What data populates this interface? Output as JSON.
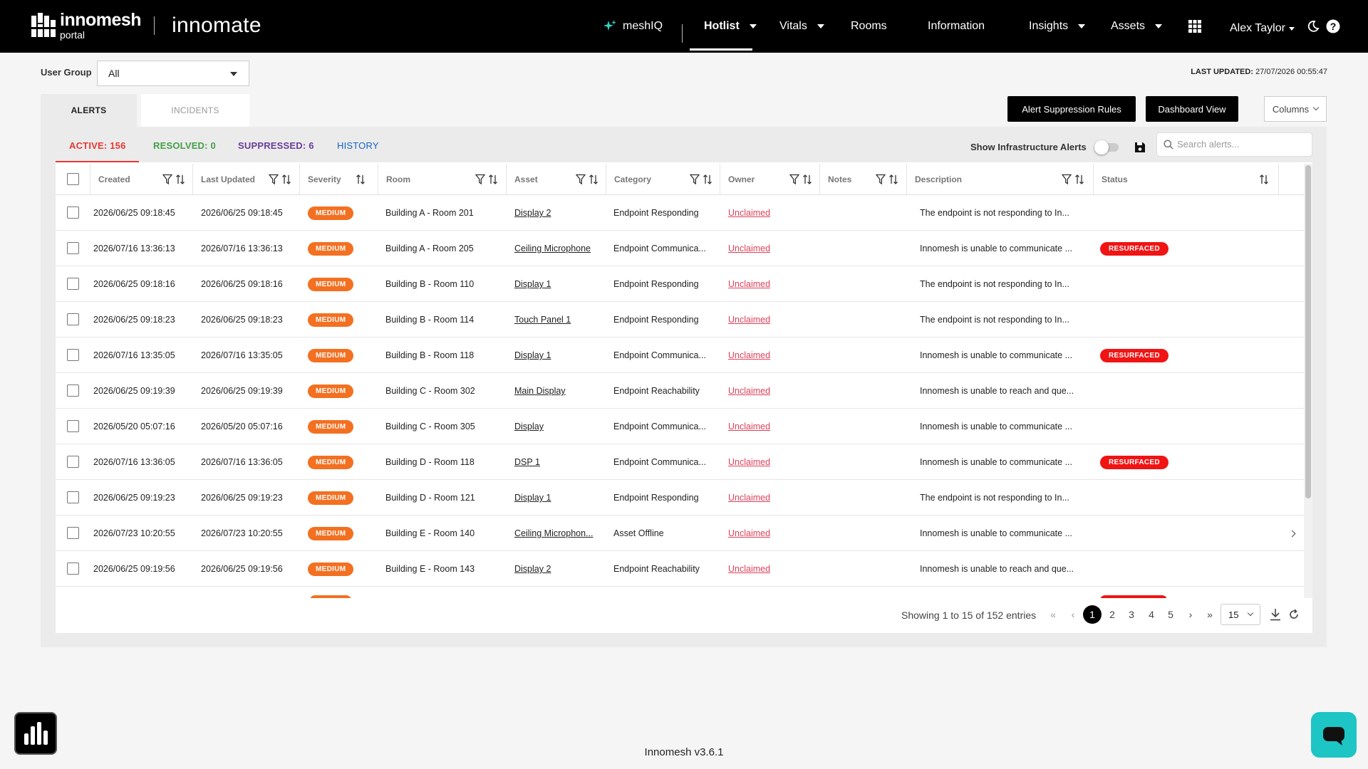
{
  "header": {
    "logo_line1": "innomesh",
    "logo_line2": "portal",
    "brand": "innomate",
    "nav": {
      "meshiq": "meshIQ",
      "hotlist": "Hotlist",
      "vitals": "Vitals",
      "rooms": "Rooms",
      "information": "Information",
      "insights": "Insights",
      "assets": "Assets",
      "user": "Alex Taylor"
    }
  },
  "controls": {
    "user_group_label": "User Group",
    "user_group_value": "All",
    "last_updated_label": "LAST UPDATED:",
    "last_updated_value": "27/07/2026 00:55:47",
    "alert_suppression_button": "Alert Suppression Rules",
    "dashboard_view_button": "Dashboard View",
    "columns_button": "Columns"
  },
  "tabs": {
    "alerts": "ALERTS",
    "incidents": "INCIDENTS"
  },
  "subtabs": {
    "active": "ACTIVE: 156",
    "resolved": "RESOLVED: 0",
    "suppressed": "SUPPRESSED: 6",
    "history": "HISTORY"
  },
  "colors": {
    "active": "#e53935",
    "resolved": "#43a047",
    "suppressed": "#6a3d9a",
    "history": "#1565c0",
    "severity_medium": "#f37021",
    "resurfaced": "#f01414",
    "owner_link": "#e0405a"
  },
  "infra": {
    "label": "Show Infrastructure Alerts",
    "enabled": false
  },
  "search": {
    "placeholder": "Search alerts..."
  },
  "table": {
    "columns": [
      "Created",
      "Last Updated",
      "Severity",
      "Room",
      "Asset",
      "Category",
      "Owner",
      "Notes",
      "Description",
      "Status"
    ],
    "rows": [
      {
        "created": "2026/06/25 09:18:45",
        "updated": "2026/06/25 09:18:45",
        "severity": "MEDIUM",
        "room": "Building A - Room 201",
        "asset": "Display 2",
        "category": "Endpoint Responding",
        "owner": "Unclaimed",
        "description": "The endpoint is not responding to In...",
        "status": ""
      },
      {
        "created": "2026/07/16 13:36:13",
        "updated": "2026/07/16 13:36:13",
        "severity": "MEDIUM",
        "room": "Building A - Room 205",
        "asset": "Ceiling Microphone",
        "category": "Endpoint Communica...",
        "owner": "Unclaimed",
        "description": "Innomesh is unable to communicate ...",
        "status": "RESURFACED"
      },
      {
        "created": "2026/06/25 09:18:16",
        "updated": "2026/06/25 09:18:16",
        "severity": "MEDIUM",
        "room": "Building B - Room 110",
        "asset": "Display 1",
        "category": "Endpoint Responding",
        "owner": "Unclaimed",
        "description": "The endpoint is not responding to In...",
        "status": ""
      },
      {
        "created": "2026/06/25 09:18:23",
        "updated": "2026/06/25 09:18:23",
        "severity": "MEDIUM",
        "room": "Building B - Room 114",
        "asset": "Touch Panel 1",
        "category": "Endpoint Responding",
        "owner": "Unclaimed",
        "description": "The endpoint is not responding to In...",
        "status": ""
      },
      {
        "created": "2026/07/16 13:35:05",
        "updated": "2026/07/16 13:35:05",
        "severity": "MEDIUM",
        "room": "Building B - Room 118",
        "asset": "Display 1",
        "category": "Endpoint Communica...",
        "owner": "Unclaimed",
        "description": "Innomesh is unable to communicate ...",
        "status": "RESURFACED"
      },
      {
        "created": "2026/06/25 09:19:39",
        "updated": "2026/06/25 09:19:39",
        "severity": "MEDIUM",
        "room": "Building C - Room 302",
        "asset": "Main Display",
        "category": "Endpoint Reachability",
        "owner": "Unclaimed",
        "description": "Innomesh is unable to reach and que...",
        "status": ""
      },
      {
        "created": "2026/05/20 05:07:16",
        "updated": "2026/05/20 05:07:16",
        "severity": "MEDIUM",
        "room": "Building C - Room 305",
        "asset": "Display",
        "category": "Endpoint Communica...",
        "owner": "Unclaimed",
        "description": "Innomesh is unable to communicate ...",
        "status": ""
      },
      {
        "created": "2026/07/16 13:36:05",
        "updated": "2026/07/16 13:36:05",
        "severity": "MEDIUM",
        "room": "Building D - Room 118",
        "asset": "DSP 1",
        "category": "Endpoint Communica...",
        "owner": "Unclaimed",
        "description": "Innomesh is unable to communicate ...",
        "status": "RESURFACED"
      },
      {
        "created": "2026/06/25 09:19:23",
        "updated": "2026/06/25 09:19:23",
        "severity": "MEDIUM",
        "room": "Building D - Room 121",
        "asset": "Display 1",
        "category": "Endpoint Responding",
        "owner": "Unclaimed",
        "description": "The endpoint is not responding to In...",
        "status": ""
      },
      {
        "created": "2026/07/23 10:20:55",
        "updated": "2026/07/23 10:20:55",
        "severity": "MEDIUM",
        "room": "Building E - Room 140",
        "asset": "Ceiling Microphon...",
        "category": "Asset Offline",
        "owner": "Unclaimed",
        "description": "Innomesh is unable to communicate ...",
        "status": ""
      },
      {
        "created": "2026/06/25 09:19:56",
        "updated": "2026/06/25 09:19:56",
        "severity": "MEDIUM",
        "room": "Building E - Room 143",
        "asset": "Display 2",
        "category": "Endpoint Reachability",
        "owner": "Unclaimed",
        "description": "Innomesh is unable to reach and que...",
        "status": ""
      }
    ]
  },
  "pagination": {
    "summary": "Showing 1 to 15 of 152 entries",
    "pages": [
      "1",
      "2",
      "3",
      "4",
      "5"
    ],
    "current": "1",
    "page_size": "15"
  },
  "footer": {
    "version": "Innomesh v3.6.1"
  }
}
